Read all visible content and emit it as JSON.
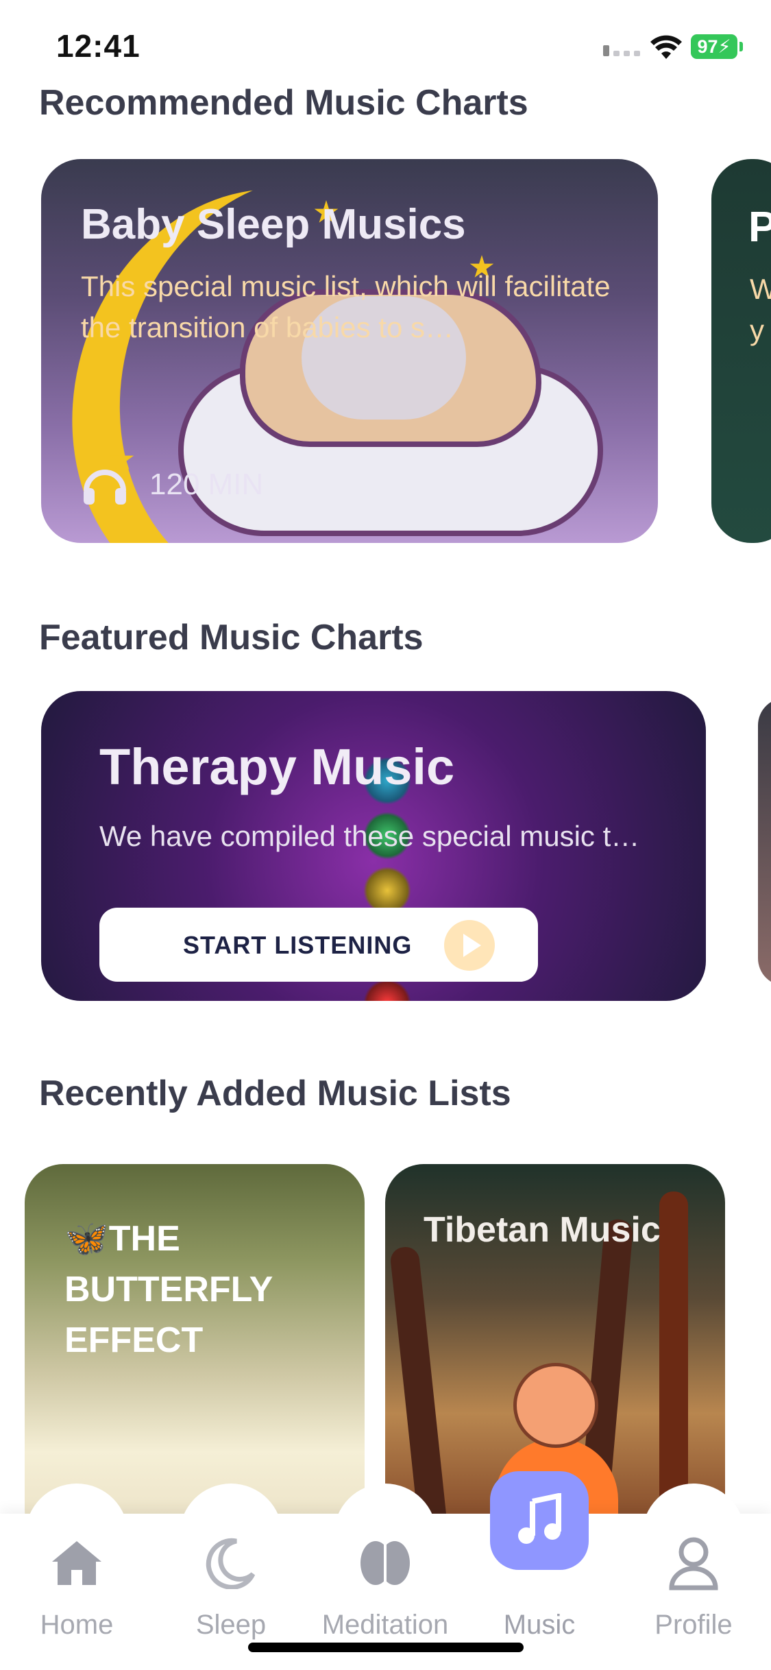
{
  "status_bar": {
    "time": "12:41",
    "battery": "97"
  },
  "sections": {
    "recommended": {
      "title": "Recommended Music Charts",
      "card": {
        "title": "Baby Sleep Musics",
        "description": "This special music list, which will facilitate the transition of babies to s…",
        "duration": "120 MIN"
      },
      "peek_card": {
        "title_partial": "P",
        "desc_partial_1": "W",
        "desc_partial_2": "y"
      }
    },
    "featured": {
      "title": "Featured Music Charts",
      "card": {
        "title": "Therapy Music",
        "description": "We have compiled these special music t…",
        "button_label": "START LISTENING"
      }
    },
    "recently_added": {
      "title": "Recently Added Music Lists",
      "items": [
        {
          "emoji": "🦋",
          "title": "THE BUTTERFLY EFFECT"
        },
        {
          "title": "Tibetan Music"
        }
      ]
    }
  },
  "bottom_nav": {
    "items": [
      {
        "label": "Home",
        "icon": "home-icon"
      },
      {
        "label": "Sleep",
        "icon": "moon-icon"
      },
      {
        "label": "Meditation",
        "icon": "brain-icon"
      },
      {
        "label": "Music",
        "icon": "music-note-icon",
        "active": true
      },
      {
        "label": "Profile",
        "icon": "profile-icon"
      }
    ],
    "active_color": "#8f96ff",
    "inactive_color": "#a6a8b0"
  }
}
